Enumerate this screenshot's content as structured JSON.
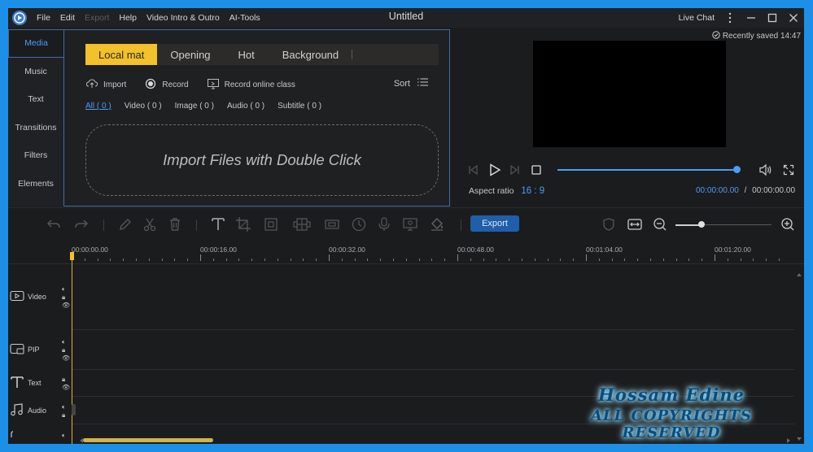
{
  "app": {
    "title": "Untitled",
    "menu": [
      {
        "label": "File",
        "enabled": true
      },
      {
        "label": "Edit",
        "enabled": true
      },
      {
        "label": "Export",
        "enabled": false
      },
      {
        "label": "Help",
        "enabled": true
      },
      {
        "label": "Video Intro & Outro",
        "enabled": true
      },
      {
        "label": "AI-Tools",
        "enabled": true
      }
    ],
    "live_chat": "Live Chat"
  },
  "left_nav": {
    "items": [
      "Media",
      "Music",
      "Text",
      "Transitions",
      "Filters",
      "Elements"
    ],
    "active": "Media"
  },
  "media": {
    "tabs": [
      "Local mat",
      "Opening",
      "Hot",
      "Background"
    ],
    "active_tab": "Local mat",
    "actions": {
      "import": "Import",
      "record": "Record",
      "record_online": "Record online class",
      "sort": "Sort"
    },
    "filters": [
      "All ( 0 )",
      "Video ( 0 )",
      "Image ( 0 )",
      "Audio ( 0 )",
      "Subtitle ( 0 )"
    ],
    "active_filter": "All ( 0 )",
    "dropzone_text": "Import Files with Double Click"
  },
  "preview": {
    "saved_text": "Recently saved 14:47",
    "aspect_label": "Aspect ratio",
    "aspect_value": "16 : 9",
    "current_time": "00:00:00.00",
    "separator": "/",
    "total_time": "00:00:00.00",
    "progress": 1.0
  },
  "toolbar": {
    "export_label": "Export",
    "zoom_level": 0.27
  },
  "timeline": {
    "ruler_labels": [
      "00:00:00.00",
      "00:00:16.00",
      "00:00:32.00",
      "00:00:48.00",
      "00:01:04.00",
      "00:01:20.00"
    ],
    "tracks": [
      {
        "name": "Video"
      },
      {
        "name": "PIP"
      },
      {
        "name": "Text"
      },
      {
        "name": "Audio"
      }
    ]
  },
  "watermark": {
    "line1": "Hossam Edine",
    "line2": "ALL COPYRIGHTS RESERVED"
  },
  "colors": {
    "accent": "#4a9ef5",
    "tab_active": "#f2c12c",
    "export_button": "#1f5ea8",
    "frame": "#1e8fe6"
  }
}
